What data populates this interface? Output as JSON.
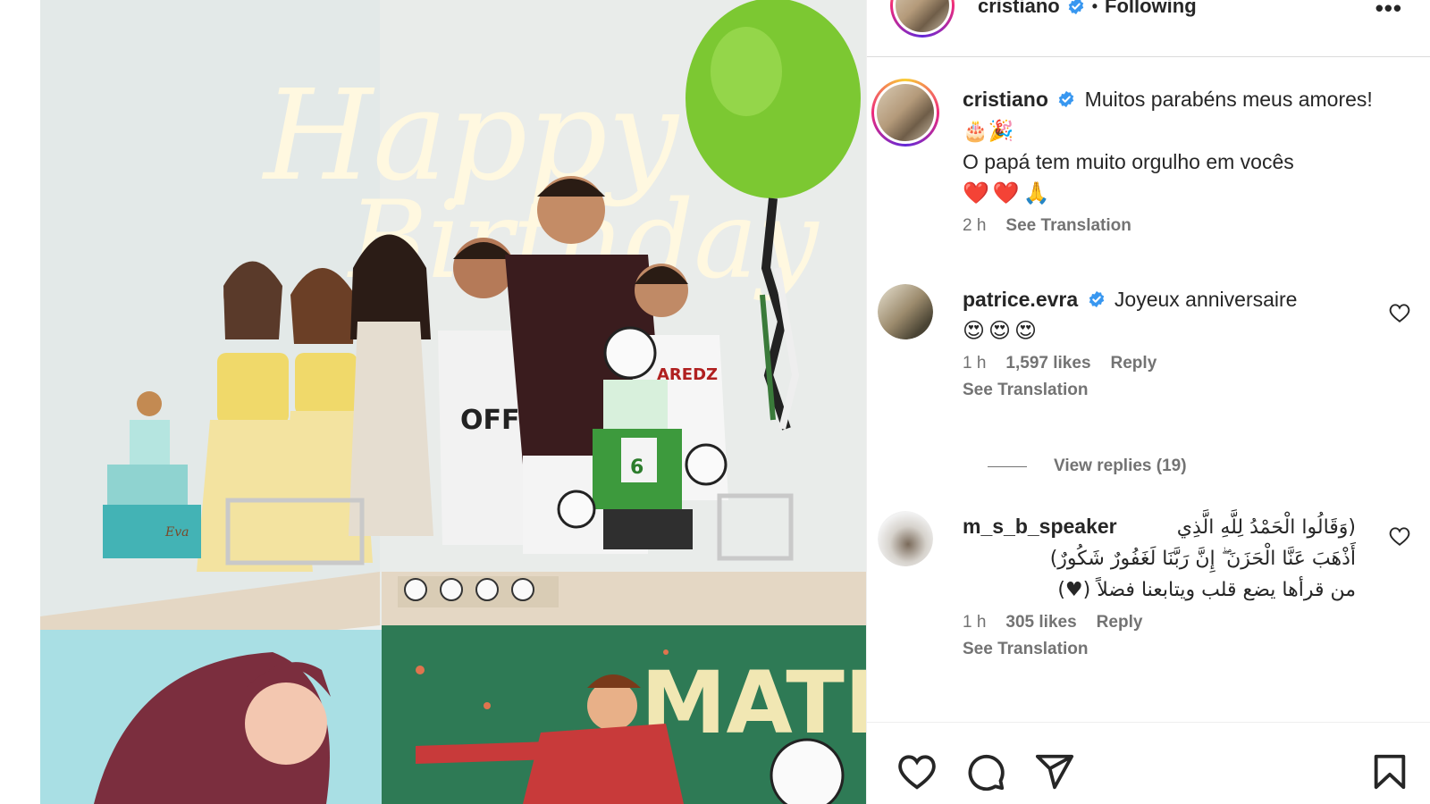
{
  "header": {
    "username": "cristiano",
    "separator": "•",
    "follow_status": "Following",
    "more_label": "•••"
  },
  "photo": {
    "neon_line1": "Happy",
    "neon_line2": "Birthday",
    "shirt_text": "OFF",
    "jersey_number": "6",
    "banner_text": "MATE",
    "cake_name": "Eva"
  },
  "caption": {
    "username": "cristiano",
    "line1": "Muitos parabéns meus amores! 🎂🎉",
    "line2": "O papá tem muito orgulho em vocês",
    "emojis": "❤️❤️🙏",
    "time": "2 h",
    "see_translation": "See Translation"
  },
  "comments": [
    {
      "username": "patrice.evra",
      "text": "Joyeux anniversaire",
      "emojis": "😍😍😍",
      "time": "1 h",
      "likes": "1,597 likes",
      "reply": "Reply",
      "see_translation": "See Translation"
    },
    {
      "username": "m_s_b_speaker",
      "text_line1": "(وَقَالُوا الْحَمْدُ لِلَّهِ الَّذِي",
      "text_line2": "أَذْهَبَ عَنَّا الْحَزَنَ ۖ إِنَّ رَبَّنَا لَغَفُورٌ شَكُورٌ)",
      "text_line3": "من قرأها يضع قلب ويتابعنا فضلاً (♥)",
      "time": "1 h",
      "likes": "305 likes",
      "reply": "Reply",
      "see_translation": "See Translation"
    }
  ],
  "view_replies": "View replies (19)",
  "colors": {
    "verified_blue": "#3897f0",
    "meta_grey": "#737373",
    "text": "#262626"
  },
  "icons": [
    "heart-icon",
    "comment-icon",
    "share-icon",
    "bookmark-icon",
    "more-icon",
    "verified-icon"
  ]
}
